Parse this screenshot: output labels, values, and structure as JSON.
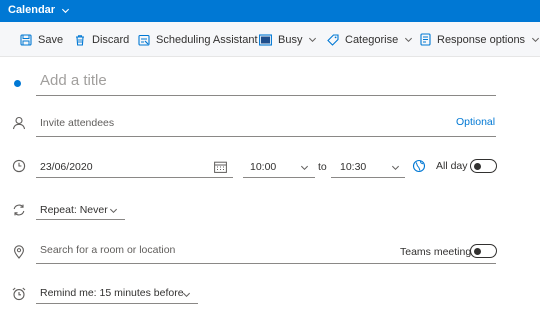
{
  "titlebar": {
    "app_label": "Calendar"
  },
  "toolbar": {
    "save": "Save",
    "discard": "Discard",
    "scheduling": "Scheduling Assistant",
    "busy": "Busy",
    "categorise": "Categorise",
    "response": "Response options"
  },
  "event": {
    "title_placeholder": "Add a title",
    "attendees_placeholder": "Invite attendees",
    "optional_label": "Optional",
    "start_date": "23/06/2020",
    "start_time": "10:00",
    "to_label": "to",
    "end_time": "10:30",
    "all_day_label": "All day",
    "repeat_label": "Repeat: Never",
    "location_placeholder": "Search for a room or location",
    "teams_label": "Teams meeting",
    "reminder_label": "Remind me: 15 minutes before"
  },
  "colors": {
    "accent": "#0078d4",
    "toolbar_bg": "#f6f7f9"
  },
  "icons": [
    "chevron-down-icon",
    "save-icon",
    "trash-icon",
    "scheduling-icon",
    "busy-icon",
    "tag-icon",
    "response-options-icon",
    "person-icon",
    "clock-icon",
    "calendar-icon",
    "globe-icon",
    "repeat-icon",
    "location-icon",
    "alarm-icon"
  ]
}
